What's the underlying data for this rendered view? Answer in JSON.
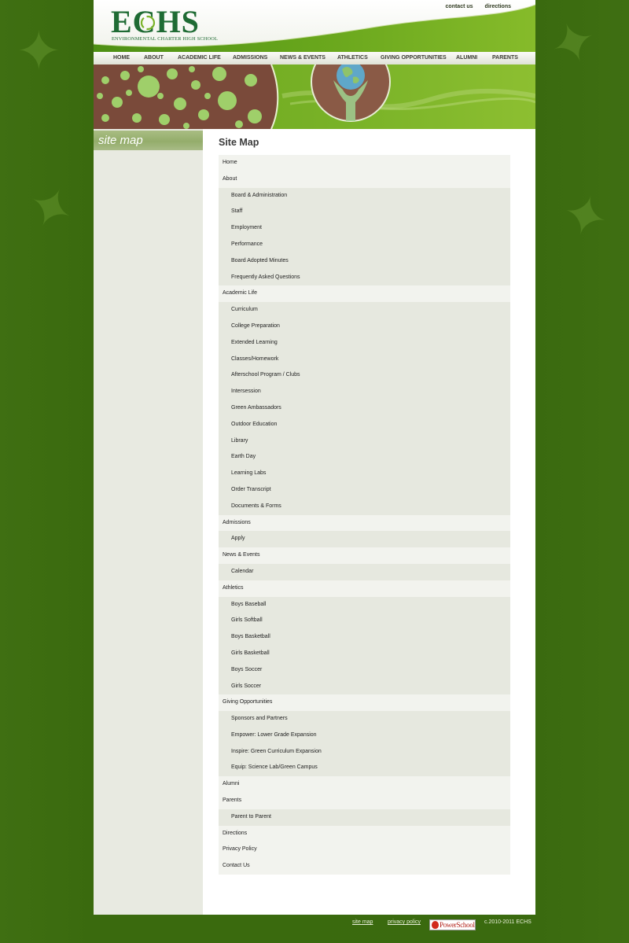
{
  "header": {
    "logo_text": "ECHS",
    "logo_subtitle": "ENVIRONMENTAL CHARTER HIGH SCHOOL",
    "top_links": [
      "contact us",
      "directions"
    ]
  },
  "nav": {
    "items": [
      "HOME",
      "ABOUT",
      "ACADEMIC LIFE",
      "ADMISSIONS",
      "NEWS & EVENTS",
      "ATHLETICS",
      "GIVING OPPORTUNITIES",
      "ALUMNI",
      "PARENTS"
    ]
  },
  "sidebar": {
    "title": "site map"
  },
  "main": {
    "title": "Site Map",
    "rows": [
      {
        "label": "Home",
        "level": "top"
      },
      {
        "label": "About",
        "level": "top"
      },
      {
        "label": "Board & Administration",
        "level": "sub"
      },
      {
        "label": "Staff",
        "level": "sub"
      },
      {
        "label": "Employment",
        "level": "sub"
      },
      {
        "label": "Performance",
        "level": "sub"
      },
      {
        "label": "Board Adopted Minutes",
        "level": "sub"
      },
      {
        "label": "Frequently Asked Questions",
        "level": "sub"
      },
      {
        "label": "Academic Life",
        "level": "top"
      },
      {
        "label": "Curriculum",
        "level": "sub"
      },
      {
        "label": "College Preparation",
        "level": "sub"
      },
      {
        "label": "Extended Learning",
        "level": "sub"
      },
      {
        "label": "Classes/Homework",
        "level": "sub"
      },
      {
        "label": "Afterschool Program / Clubs",
        "level": "sub"
      },
      {
        "label": "Intersession",
        "level": "sub"
      },
      {
        "label": "Green Ambassadors",
        "level": "sub"
      },
      {
        "label": "Outdoor Education",
        "level": "sub"
      },
      {
        "label": "Library",
        "level": "sub"
      },
      {
        "label": "Earth Day",
        "level": "sub"
      },
      {
        "label": "Learning Labs",
        "level": "sub"
      },
      {
        "label": "Order Transcript",
        "level": "sub"
      },
      {
        "label": "Documents & Forms",
        "level": "sub"
      },
      {
        "label": "Admissions",
        "level": "top"
      },
      {
        "label": "Apply",
        "level": "sub"
      },
      {
        "label": "News & Events",
        "level": "top"
      },
      {
        "label": "Calendar",
        "level": "sub"
      },
      {
        "label": "Athletics",
        "level": "top"
      },
      {
        "label": "Boys Baseball",
        "level": "sub"
      },
      {
        "label": "Girls Softball",
        "level": "sub"
      },
      {
        "label": "Boys Basketball",
        "level": "sub"
      },
      {
        "label": "Girls Basketball",
        "level": "sub"
      },
      {
        "label": "Boys Soccer",
        "level": "sub"
      },
      {
        "label": "Girls Soccer",
        "level": "sub"
      },
      {
        "label": "Giving Opportunities",
        "level": "top"
      },
      {
        "label": "Sponsors and Partners",
        "level": "sub"
      },
      {
        "label": "Empower: Lower Grade Expansion",
        "level": "sub"
      },
      {
        "label": "Inspire: Green Curriculum Expansion",
        "level": "sub"
      },
      {
        "label": "Equip: Science Lab/Green Campus",
        "level": "sub"
      },
      {
        "label": "Alumni",
        "level": "top"
      },
      {
        "label": "Parents",
        "level": "top"
      },
      {
        "label": "Parent to Parent",
        "level": "sub"
      },
      {
        "label": "Directions",
        "level": "top"
      },
      {
        "label": "Privacy Policy",
        "level": "top"
      },
      {
        "label": "Contact Us",
        "level": "top"
      }
    ]
  },
  "footer": {
    "links": [
      "site map",
      "privacy policy"
    ],
    "badge_text": "PowerSchool",
    "copyright": "c.2010-2011 ECHS"
  },
  "icons": [
    "leaf-icon",
    "recycle-icon",
    "globe-icon",
    "apple-icon"
  ],
  "colors": {
    "background_green": "#3a6a0e",
    "brand_green": "#1f6b34",
    "banner_green": "#7ab328",
    "sidebar_bg": "#e8eae1"
  }
}
